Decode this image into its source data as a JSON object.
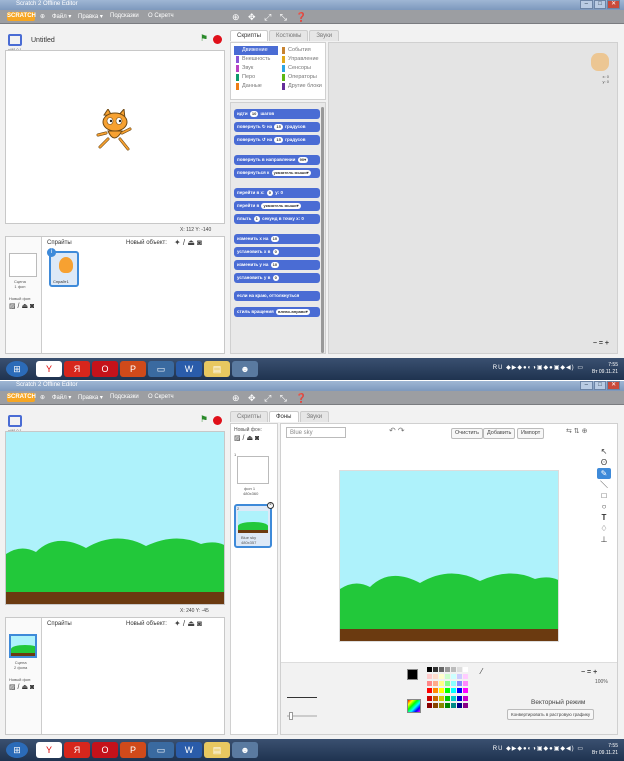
{
  "window": {
    "title": "Scratch 2 Offline Editor",
    "controls": [
      "–",
      "□",
      "✕"
    ]
  },
  "menu": {
    "logo": "SCRATCH",
    "items": [
      "Файл ▾",
      "Правка ▾",
      "Подсказки",
      "О Скретч"
    ],
    "icons": "⊕ ✥ ⤢ ⤡ ❓"
  },
  "project": {
    "title": "Untitled",
    "version": "v461.0.1"
  },
  "shot1": {
    "tabs": [
      "Скрипты",
      "Костюмы",
      "Звуки"
    ],
    "categories_left": [
      "Движение",
      "Внешность",
      "Звук",
      "Перо",
      "Данные"
    ],
    "categories_right": [
      "События",
      "Управление",
      "Сенсоры",
      "Операторы",
      "Другие блоки"
    ],
    "cat_colors_left": [
      "#4a6cd4",
      "#8a55d7",
      "#bb42c3",
      "#0e9a6c",
      "#ee7d16"
    ],
    "cat_colors_right": [
      "#c88330",
      "#e1a91a",
      "#2ca5e2",
      "#5cb712",
      "#632d99"
    ],
    "blocks": [
      {
        "pre": "идти",
        "v": "10",
        "post": "шагов"
      },
      {
        "pre": "повернуть ↻ на",
        "v": "15",
        "post": "градусов"
      },
      {
        "pre": "повернуть ↺ на",
        "v": "15",
        "post": "градусов"
      },
      {
        "pre": "повернуть в направлении",
        "v": "90▾",
        "post": ""
      },
      {
        "pre": "повернуться к",
        "v": "указатель мыши▾",
        "post": ""
      },
      {
        "pre": "перейти в x:",
        "v": "0",
        "post": "y: 0"
      },
      {
        "pre": "перейти в",
        "v": "указатель мыши▾",
        "post": ""
      },
      {
        "pre": "плыть",
        "v": "1",
        "post": "секунд в точку x: 0"
      },
      {
        "pre": "изменить х на",
        "v": "10",
        "post": ""
      },
      {
        "pre": "установить х в",
        "v": "0",
        "post": ""
      },
      {
        "pre": "изменить у на",
        "v": "10",
        "post": ""
      },
      {
        "pre": "установить у в",
        "v": "0",
        "post": ""
      },
      {
        "pre": "если на краю, оттолкнуться",
        "v": "",
        "post": ""
      },
      {
        "pre": "стиль вращения",
        "v": "влево-вправо▾",
        "post": ""
      }
    ],
    "coords": "X: 112  Y: -140",
    "sprite_xy": "x: 0\ny: 0",
    "sprites_label": "Спрайты",
    "new_object": "Новый объект:",
    "stage_thumb_label": "Сцена\n1 фон",
    "new_bg": "Новый фон:",
    "sprite_name": "Спрайт1",
    "zoom": "− = +"
  },
  "shot2": {
    "tabs": [
      "Скрипты",
      "Фоны",
      "Звуки"
    ],
    "new_bg": "Новый фон:",
    "bg_name": "Blue sky",
    "backdrops": [
      {
        "num": "1",
        "name": "фон 1",
        "size": "480x360"
      },
      {
        "num": "2",
        "name": "Blue sky",
        "size": "480x357"
      }
    ],
    "buttons": [
      "Очистить",
      "Добавить",
      "Импорт"
    ],
    "coords": "X: 240  Y: -45",
    "sprites_label": "Спрайты",
    "new_object": "Новый объект:",
    "stage_thumb_label": "Сцена\n2 фона",
    "new_bg_left": "Новый фон:",
    "zoom_pct": "100%",
    "mode": "Векторный режим",
    "convert": "Конвертировать в растровую графику",
    "zoom": "− = +"
  },
  "taskbar": {
    "time1": "7:55",
    "date1": "Вт 09.11.21",
    "time2": "7:55",
    "date2": "Вт 09.11.21",
    "lang": "RU"
  }
}
